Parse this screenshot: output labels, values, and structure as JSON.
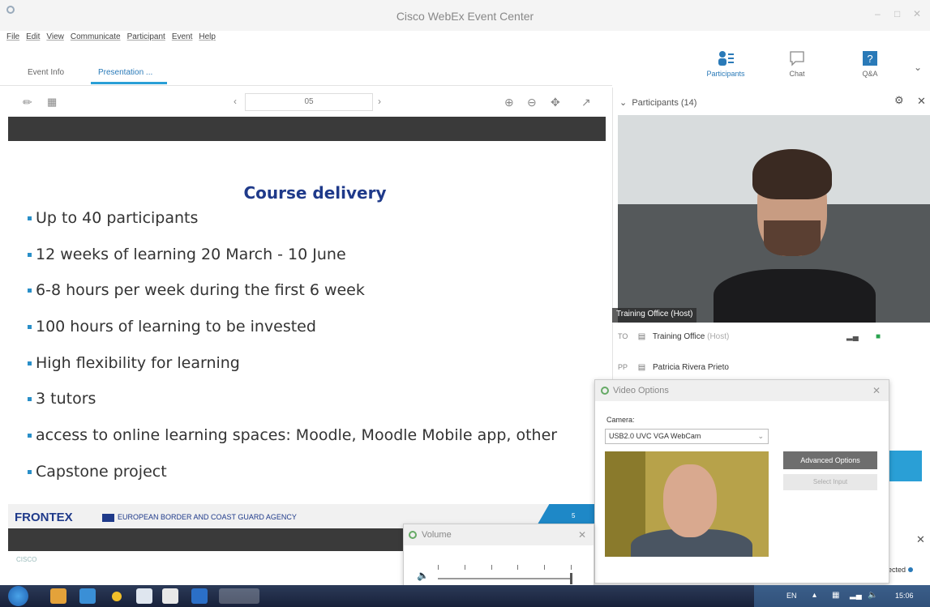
{
  "window": {
    "title": "Cisco WebEx Event Center",
    "controls": [
      "–",
      "□",
      "✕"
    ]
  },
  "menu": [
    "File",
    "Edit",
    "View",
    "Communicate",
    "Participant",
    "Event",
    "Help"
  ],
  "tabs": [
    {
      "label": "Event Info",
      "active": false
    },
    {
      "label": "Presentation ...",
      "active": true
    }
  ],
  "top_panels": [
    {
      "label": "Participants",
      "icon": "participants-icon",
      "active": true
    },
    {
      "label": "Chat",
      "icon": "chat-icon",
      "active": false
    },
    {
      "label": "Q&A",
      "icon": "qa-icon",
      "active": false
    }
  ],
  "toolbar": {
    "page": "05",
    "tools": [
      "zoom-in-icon",
      "zoom-out-icon",
      "pan-icon",
      "fullscreen-icon"
    ]
  },
  "slide": {
    "heading": "Course delivery",
    "bullets": [
      "Up to 40 participants",
      "12 weeks of learning 20 March - 10 June",
      "6-8 hours per week during the first 6 week",
      "100 hours of learning to be invested",
      "High flexibility for learning",
      "3 tutors",
      "access to online learning spaces: Moodle, Moodle Mobile app, other",
      "Capstone project"
    ],
    "footer_logo": "FRONTEX",
    "footer_agency": "EUROPEAN BORDER AND COAST GUARD AGENCY",
    "footer_page": "5"
  },
  "brand": "CISCO",
  "participants": {
    "header": "Participants (14)",
    "video_label": "Training Office (Host)",
    "rows": [
      {
        "initials": "TO",
        "name": "Training Office",
        "tag": "(Host)"
      },
      {
        "initials": "PP",
        "name": "Patricia Rivera Prieto",
        "tag": ""
      }
    ],
    "status_text": "ected"
  },
  "video_options": {
    "title": "Video Options",
    "camera_label": "Camera:",
    "camera_value": "USB2.0 UVC VGA WebCam",
    "advanced_button": "Advanced Options",
    "select_input_button": "Select Input"
  },
  "volume": {
    "title": "Volume",
    "level": 1.0
  },
  "taskbar": {
    "lang": "EN",
    "time": "15:06"
  },
  "colors": {
    "accent": "#2a9fd6",
    "slide_heading": "#1f3a8a",
    "bullet": "#2a8fc8"
  }
}
